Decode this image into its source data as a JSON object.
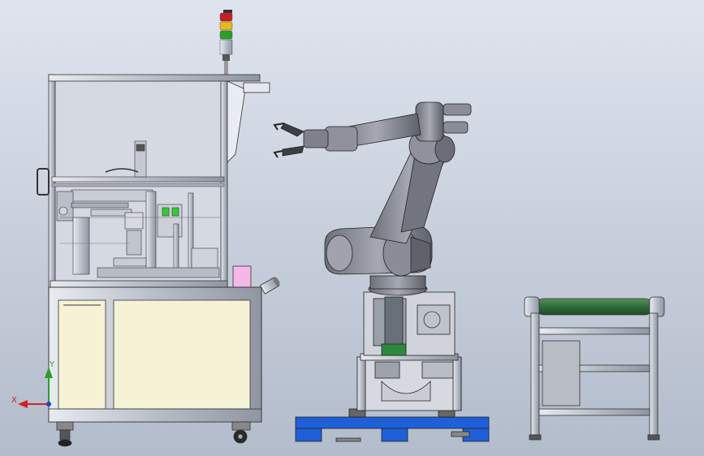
{
  "viewport": {
    "background_top": "#dfe4ee",
    "background_bottom": "#b3bccb"
  },
  "triad": {
    "x_label": "X",
    "y_label": "Y",
    "x_color": "#d42020",
    "y_color": "#2a9d2a",
    "z_color": "#1f3fd0"
  },
  "stack_light": {
    "colors": [
      "#c81e1e",
      "#e8b81a",
      "#2aa02a"
    ]
  },
  "colors": {
    "frame_metal": "#c9ced6",
    "panel_cream": "#f6f2d6",
    "robot_body": "#8e9099",
    "pallet_blue": "#1f5fd8",
    "conveyor_belt": "#2f6b3a",
    "pink_block": "#f3b7e8"
  }
}
